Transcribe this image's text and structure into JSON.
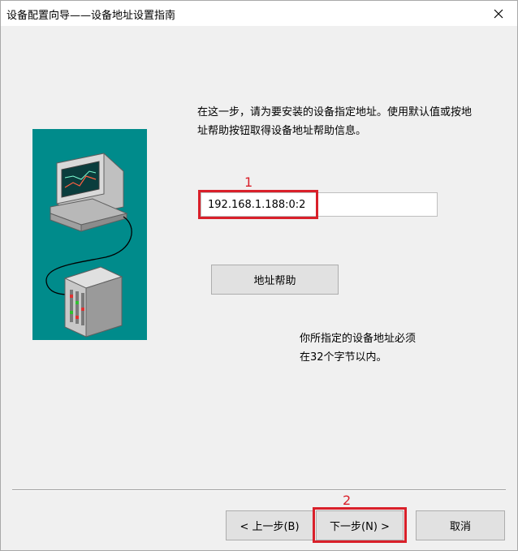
{
  "window": {
    "title": "设备配置向导——设备地址设置指南",
    "close_icon": "close-icon"
  },
  "illustration": {
    "icon": "computer-device-icon",
    "bg_color": "#008b8b"
  },
  "main": {
    "description": "在这一步，请为要安装的设备指定地址。使用默认值或按地址帮助按钮取得设备地址帮助信息。",
    "address_value": "192.168.1.188:0:2",
    "help_button": "地址帮助",
    "note_line1": "你所指定的设备地址必须",
    "note_line2": "在32个字节以内。"
  },
  "annotations": {
    "marker1": "1",
    "marker2": "2",
    "color": "#d9202a"
  },
  "footer": {
    "back_button": "< 上一步(B)",
    "next_button": "下一步(N) >",
    "cancel_button": "取消"
  }
}
